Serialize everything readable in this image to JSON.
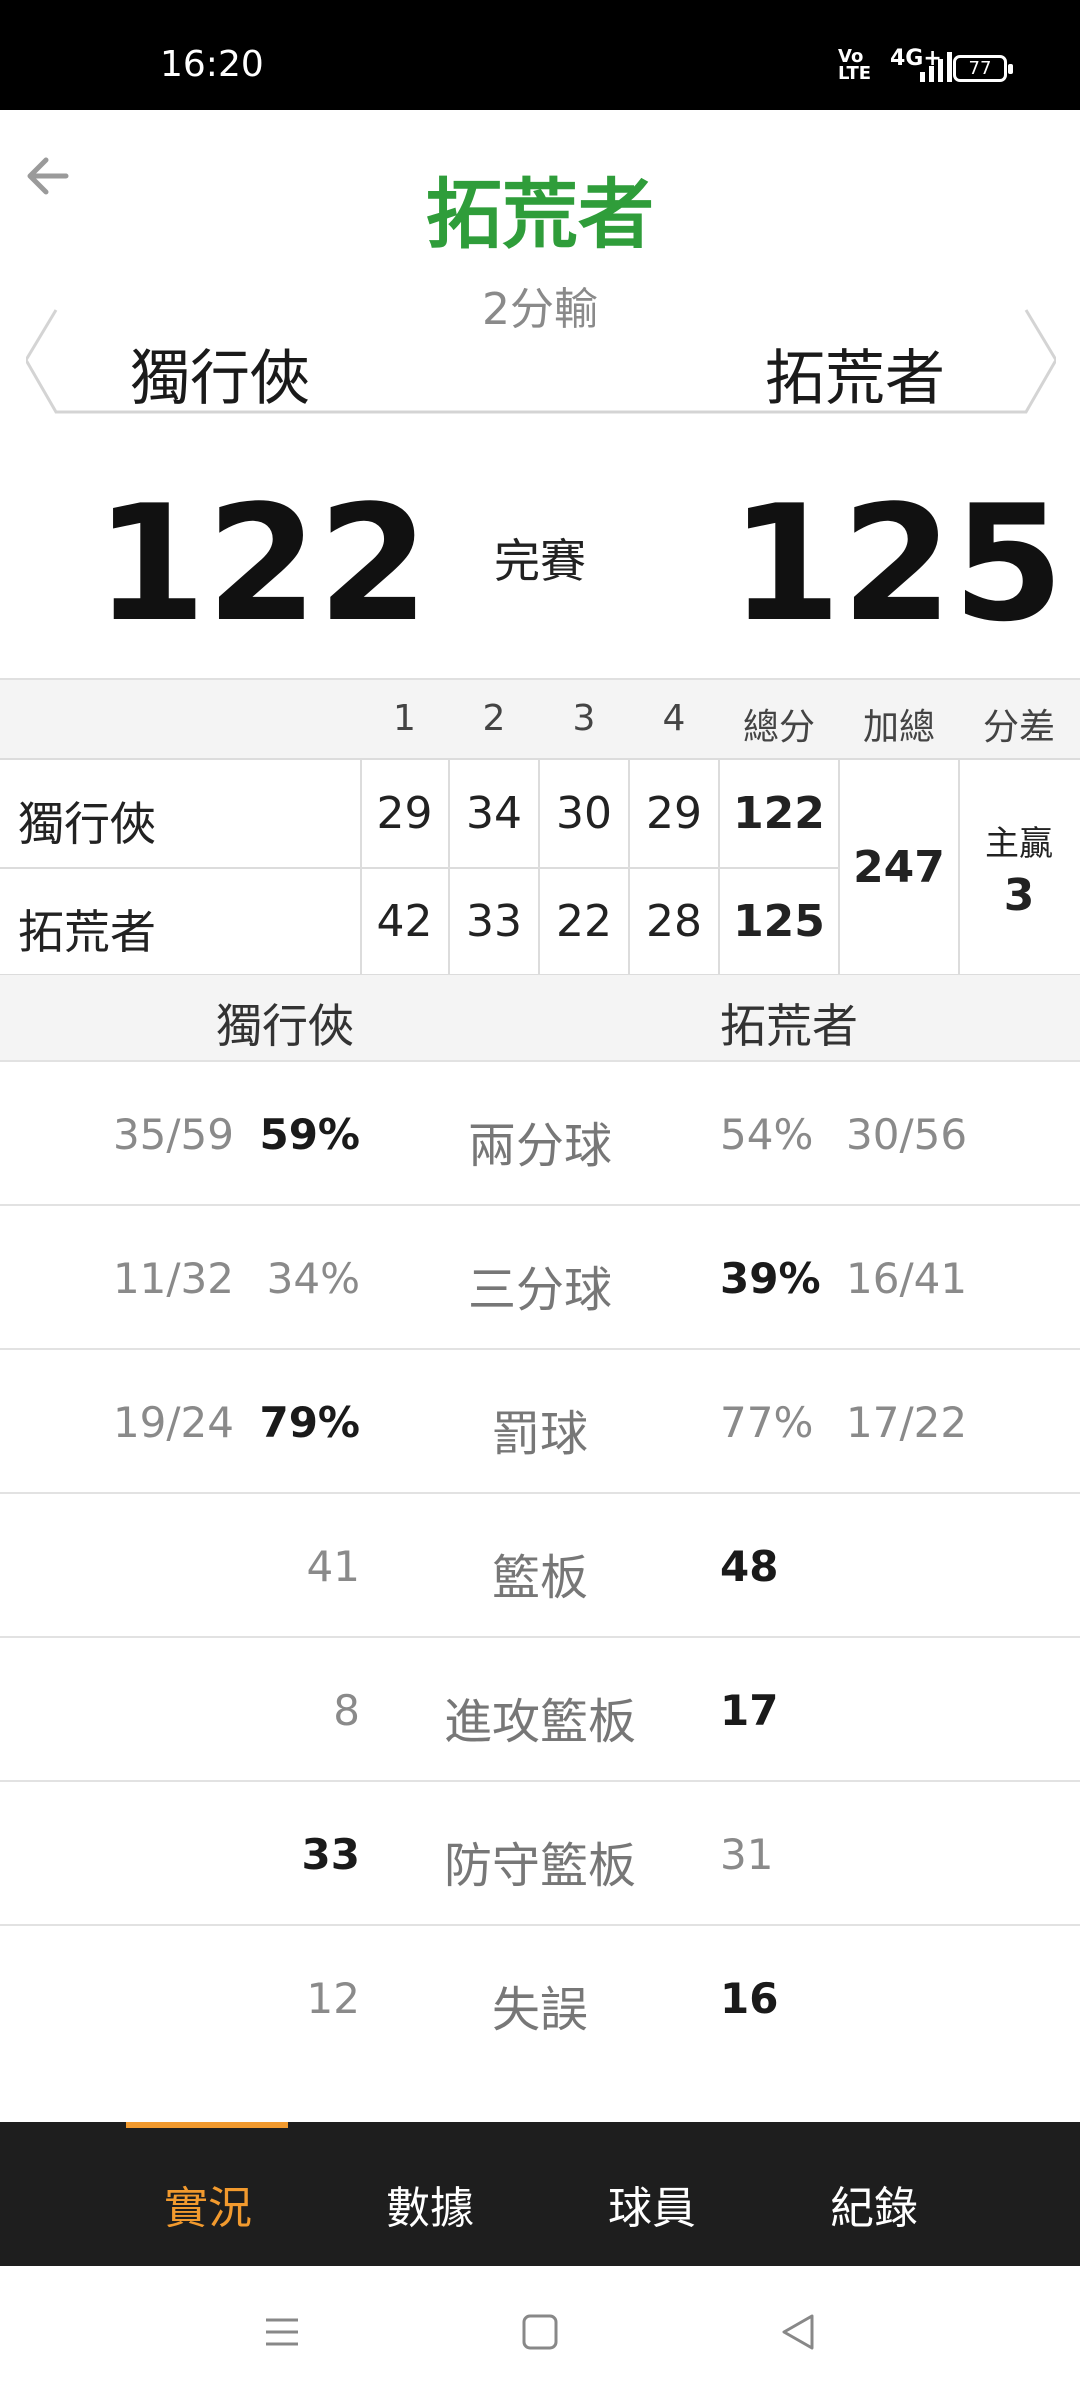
{
  "status_bar": {
    "time": "16:20",
    "volte": "Vo LTE",
    "network": "4G+",
    "battery": "77"
  },
  "header": {
    "winner": "拓荒者",
    "result": "2分輸",
    "team_left": "獨行俠",
    "team_right": "拓荒者"
  },
  "score": {
    "left": "122",
    "status": "完賽",
    "right": "125"
  },
  "quarter_table": {
    "headers": [
      "1",
      "2",
      "3",
      "4",
      "總分",
      "加總",
      "分差"
    ],
    "rows": [
      {
        "team": "獨行俠",
        "q": [
          "29",
          "34",
          "30",
          "29"
        ],
        "total": "122"
      },
      {
        "team": "拓荒者",
        "q": [
          "42",
          "33",
          "22",
          "28"
        ],
        "total": "125"
      }
    ],
    "sum": "247",
    "diff_label": "主贏",
    "diff_value": "3"
  },
  "stats_header": {
    "left": "獨行俠",
    "right": "拓荒者"
  },
  "stats": [
    {
      "label": "兩分球",
      "left_ratio": "35/59",
      "left": "59%",
      "right": "54%",
      "right_ratio": "30/56",
      "left_bold": true,
      "right_bold": false
    },
    {
      "label": "三分球",
      "left_ratio": "11/32",
      "left": "34%",
      "right": "39%",
      "right_ratio": "16/41",
      "left_bold": false,
      "right_bold": true
    },
    {
      "label": "罰球",
      "left_ratio": "19/24",
      "left": "79%",
      "right": "77%",
      "right_ratio": "17/22",
      "left_bold": true,
      "right_bold": false
    },
    {
      "label": "籃板",
      "left_ratio": "",
      "left": "41",
      "right": "48",
      "right_ratio": "",
      "left_bold": false,
      "right_bold": true
    },
    {
      "label": "進攻籃板",
      "left_ratio": "",
      "left": "8",
      "right": "17",
      "right_ratio": "",
      "left_bold": false,
      "right_bold": true
    },
    {
      "label": "防守籃板",
      "left_ratio": "",
      "left": "33",
      "right": "31",
      "right_ratio": "",
      "left_bold": true,
      "right_bold": false
    },
    {
      "label": "失誤",
      "left_ratio": "",
      "left": "12",
      "right": "16",
      "right_ratio": "",
      "left_bold": false,
      "right_bold": true
    }
  ],
  "bottom_nav": {
    "tabs": [
      "實況",
      "數據",
      "球員",
      "紀錄"
    ],
    "active": "實況"
  },
  "colors": {
    "winner_green": "#2f9d3a",
    "accent_orange": "#f29a2e",
    "nav_bg": "#1e1e1e"
  }
}
